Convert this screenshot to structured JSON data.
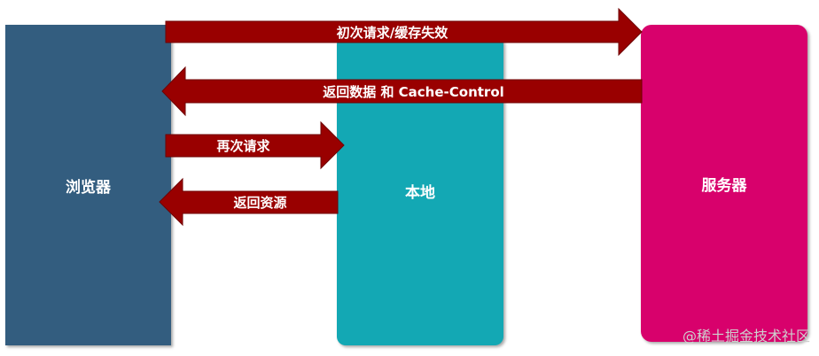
{
  "nodes": {
    "browser": "浏览器",
    "local": "本地",
    "server": "服务器"
  },
  "arrows": {
    "first_request": "初次请求/缓存失效",
    "return_data": "返回数据 和 Cache-Control",
    "second_request": "再次请求",
    "return_resource": "返回资源"
  },
  "watermark": "@稀土掘金技术社区",
  "colors": {
    "browser": "#335d7f",
    "local": "#13a8b4",
    "server": "#d8016c",
    "arrow": "#990000"
  }
}
